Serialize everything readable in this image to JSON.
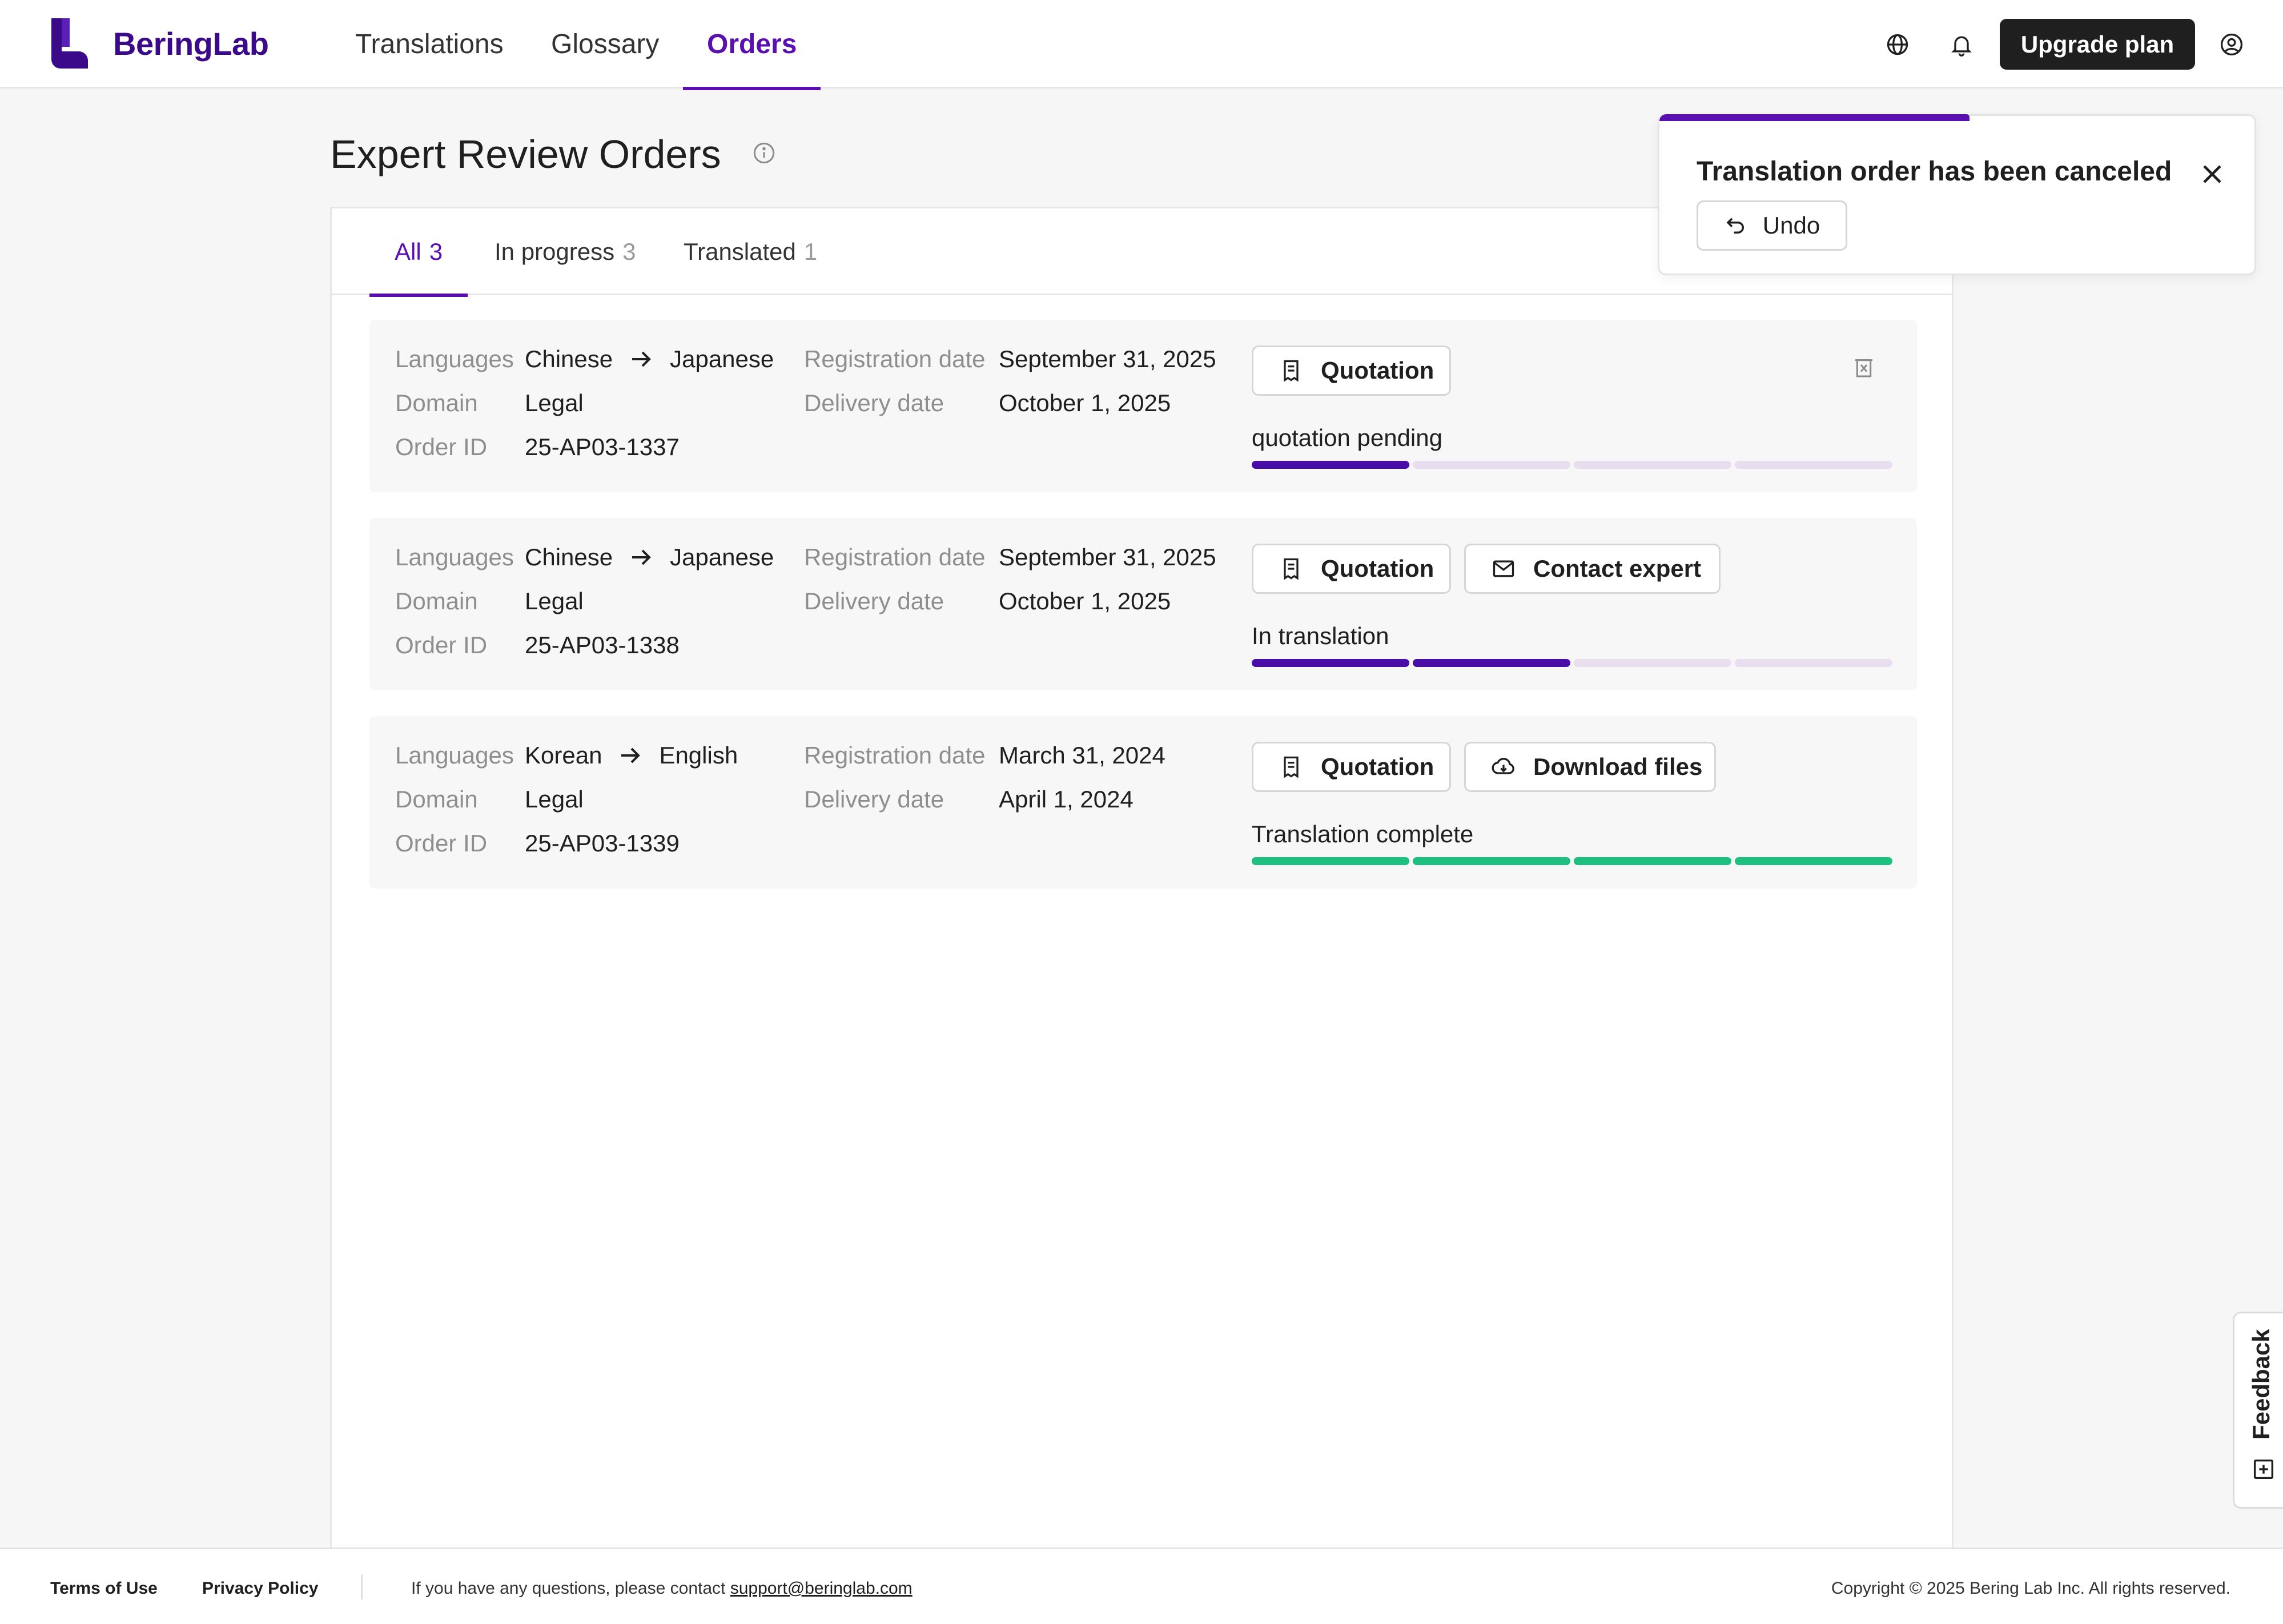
{
  "brand": {
    "name": "BeringLab",
    "color": "#3b0a8a"
  },
  "nav": {
    "items": [
      {
        "label": "Translations"
      },
      {
        "label": "Glossary"
      },
      {
        "label": "Orders"
      }
    ],
    "active": "Orders"
  },
  "header": {
    "upgrade_label": "Upgrade plan",
    "icons": [
      "globe-icon",
      "bell-icon",
      "user-circle-icon"
    ]
  },
  "page": {
    "title": "Expert Review Orders"
  },
  "tabs": [
    {
      "label": "All",
      "count": "3"
    },
    {
      "label": "In progress",
      "count": "3"
    },
    {
      "label": "Translated",
      "count": "1"
    }
  ],
  "labels": {
    "languages": "Languages",
    "domain": "Domain",
    "order_id": "Order ID",
    "registration_date": "Registration date",
    "delivery_date": "Delivery date"
  },
  "orders": [
    {
      "source_lang": "Chinese",
      "target_lang": "Japanese",
      "domain": "Legal",
      "order_id": "25-AP03-1337",
      "registration_date": "September 31, 2025",
      "delivery_date": "October 1, 2025",
      "buttons": [
        "Quotation"
      ],
      "status": "quotation pending",
      "progress_steps_filled": 1,
      "progress_steps_total": 4,
      "progress_color": "#4a0ea8"
    },
    {
      "source_lang": "Chinese",
      "target_lang": "Japanese",
      "domain": "Legal",
      "order_id": "25-AP03-1338",
      "registration_date": "September 31, 2025",
      "delivery_date": "October 1, 2025",
      "buttons": [
        "Quotation",
        "Contact expert"
      ],
      "status": "In translation",
      "progress_steps_filled": 2,
      "progress_steps_total": 4,
      "progress_color": "#4a0ea8"
    },
    {
      "source_lang": "Korean",
      "target_lang": "English",
      "domain": "Legal",
      "order_id": "25-AP03-1339",
      "registration_date": "March 31, 2024",
      "delivery_date": "April 1, 2024",
      "buttons": [
        "Quotation",
        "Download files"
      ],
      "status": "Translation complete",
      "progress_steps_filled": 4,
      "progress_steps_total": 4,
      "progress_color": "#1fbf7f"
    }
  ],
  "toast": {
    "message": "Translation order has been canceled",
    "undo_label": "Undo"
  },
  "feedback": {
    "label": "Feedback"
  },
  "footer": {
    "terms": "Terms of Use",
    "privacy": "Privacy Policy",
    "contact_text": "If you have any questions, please contact ",
    "email": "support@beringlab.com",
    "copyright": "Copyright © 2025 Bering Lab Inc. All rights reserved."
  },
  "colors": {
    "accent": "#5a0fb0",
    "progress_purple": "#4a0ea8",
    "progress_green": "#1fbf7f",
    "progress_track": "#e8deef"
  }
}
